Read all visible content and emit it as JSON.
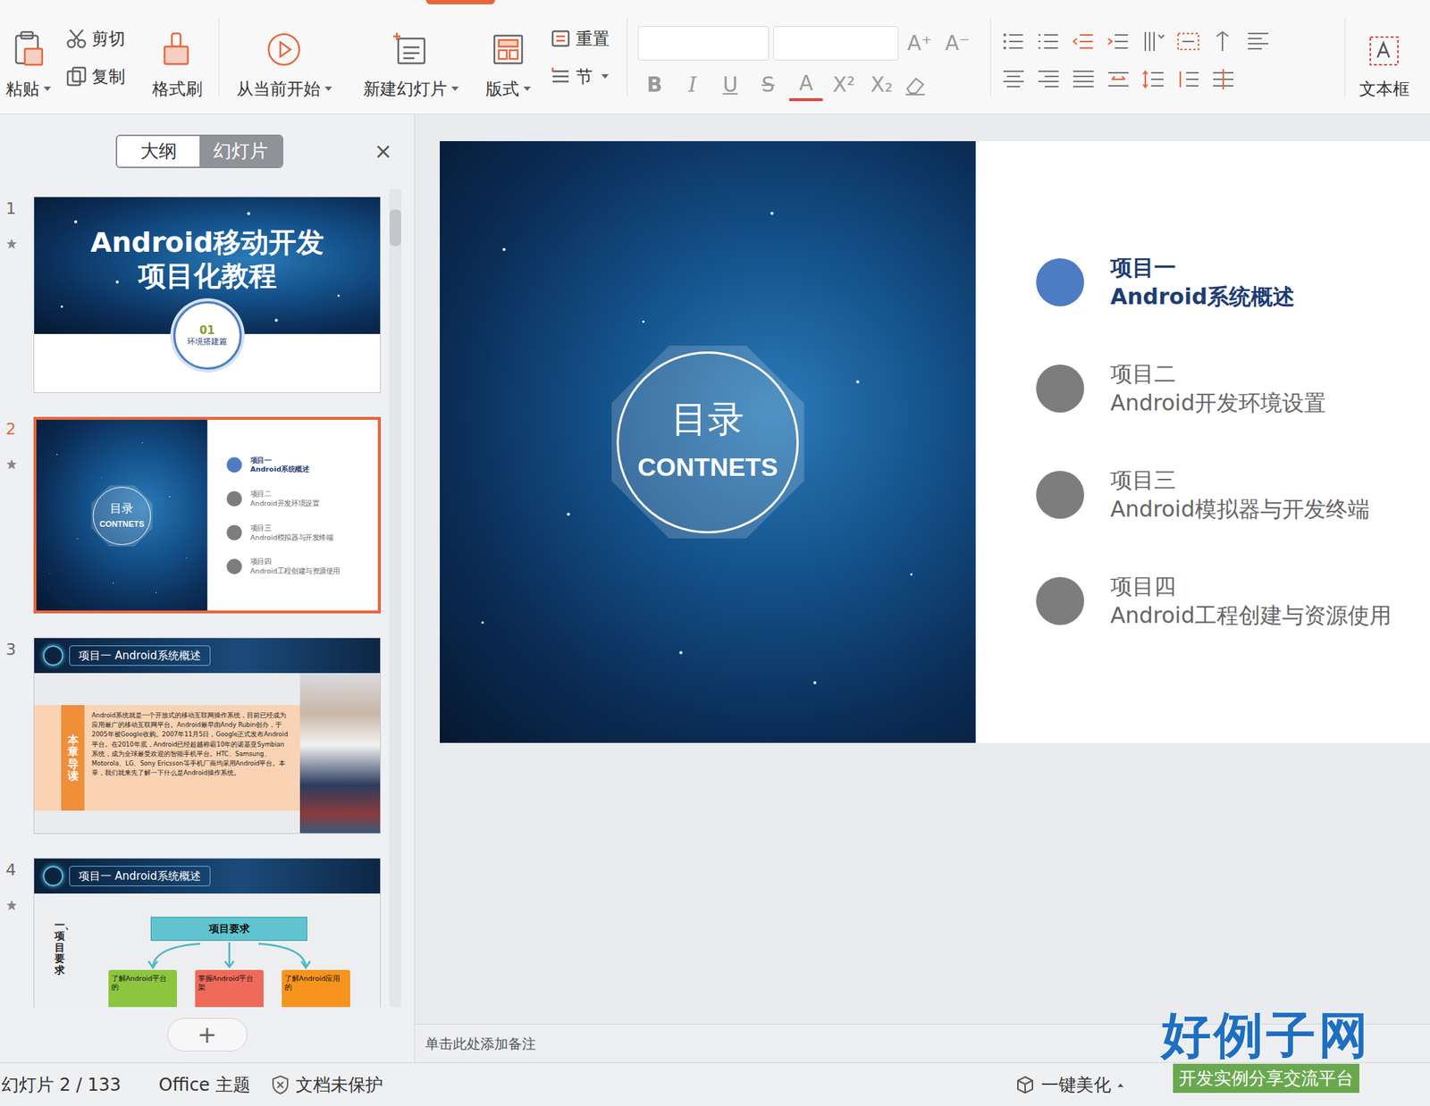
{
  "ribbon": {
    "paste": "粘贴",
    "cut": "剪切",
    "copy": "复制",
    "format_painter": "格式刷",
    "start_current": "从当前开始",
    "new_slide": "新建幻灯片",
    "layout": "版式",
    "reset": "重置",
    "section": "节",
    "font_grow": "A⁺",
    "font_shrink": "A⁻",
    "format_buttons": [
      {
        "label": "B",
        "kind": "bold",
        "disabled": true
      },
      {
        "label": "I",
        "kind": "italic",
        "disabled": true
      },
      {
        "label": "U",
        "kind": "underline",
        "disabled": true
      },
      {
        "label": "S",
        "kind": "strike",
        "disabled": true
      },
      {
        "label": "A",
        "kind": "color",
        "disabled": true
      },
      {
        "label": "X²",
        "kind": "plain",
        "disabled": true
      },
      {
        "label": "X₂",
        "kind": "plain",
        "disabled": true
      }
    ],
    "text_box": "文本框"
  },
  "panel": {
    "tabs": [
      {
        "label": "大纲",
        "selected": false
      },
      {
        "label": "幻灯片",
        "selected": true
      }
    ],
    "close": "×",
    "add": "+",
    "slides": [
      {
        "number": "1",
        "selected": false,
        "animated": true,
        "kind": "title",
        "title": "Android移动开发",
        "subtitle": "项目化教程",
        "badge_number": "01",
        "badge_label": "环境搭建篇"
      },
      {
        "number": "2",
        "selected": true,
        "animated": true,
        "kind": "toc"
      },
      {
        "number": "3",
        "selected": false,
        "animated": false,
        "kind": "intro",
        "header": "项目一 Android系统概述",
        "side_label": "本章导读",
        "body": "Android系统就是一个开放式的移动互联网操作系统，目前已经成为应用最广的移动互联网平台。Android最早由Andy Rubin创办，于2005年被Google收购。2007年11月5日，Google正式发布Android平台。在2010年底，Android已经超越称霸10年的诺基亚Symbian系统，成为全球最受欢迎的智能手机平台。HTC、Samsung、Motorola、LG、Sony Ericsson等手机厂商均采用Android平台。本章，我们就来先了解一下什么是Android操作系统。"
      },
      {
        "number": "4",
        "selected": false,
        "animated": true,
        "kind": "requirements",
        "header": "项目一 Android系统概述",
        "side_label": "一、项目要求",
        "center": "项目要求",
        "boxes": [
          {
            "text": "了解Android平台的",
            "color": "#8cc540"
          },
          {
            "text": "掌握Android平台架",
            "color": "#f06a5a"
          },
          {
            "text": "了解Android应用的",
            "color": "#f7941d"
          }
        ]
      }
    ]
  },
  "current_slide": {
    "badge_title": "目录",
    "badge_subtitle": "CONTNETS",
    "items": [
      {
        "title": "项目一",
        "subtitle": "Android系统概述",
        "selected": true
      },
      {
        "title": "项目二",
        "subtitle": "Android开发环境设置",
        "selected": false
      },
      {
        "title": "项目三",
        "subtitle": "Android模拟器与开发终端",
        "selected": false
      },
      {
        "title": "项目四",
        "subtitle": "Android工程创建与资源使用",
        "selected": false
      }
    ]
  },
  "notes": {
    "placeholder": "单击此处添加备注"
  },
  "status_bar": {
    "slide_counter": "幻灯片 2 / 133",
    "theme": "Office 主题",
    "protection": "文档未保护",
    "beautify": "一键美化"
  },
  "logo": {
    "title": "好例子网",
    "tagline": "开发实例分享交流平台"
  }
}
